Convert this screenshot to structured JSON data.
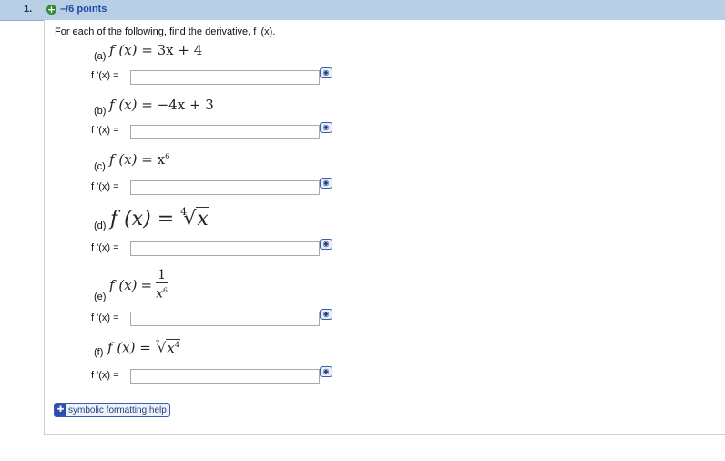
{
  "question": {
    "number": "1.",
    "points": "–/6 points",
    "prompt": "For each of the following, find the derivative, f '(x).",
    "answer_label": "f '(x) =",
    "parts": [
      {
        "label": "(a)",
        "answer": ""
      },
      {
        "label": "(b)",
        "answer": ""
      },
      {
        "label": "(c)",
        "answer": ""
      },
      {
        "label": "(d)",
        "answer": ""
      },
      {
        "label": "(e)",
        "answer": ""
      },
      {
        "label": "(f)",
        "answer": ""
      }
    ],
    "formulas": {
      "a": {
        "lhs": "f (x)",
        "rhs": "= 3x + 4"
      },
      "b": {
        "lhs": "f (x)",
        "rhs": "= −4x + 3"
      },
      "c": {
        "lhs": "f (x)",
        "base": "= x",
        "exp": "6"
      },
      "d": {
        "lhs": "f (x)",
        "eq": "=",
        "index": "4",
        "radicand": "x"
      },
      "e": {
        "lhs": "f (x)",
        "eq": "=",
        "num": "1",
        "den_base": "x",
        "den_exp": "6"
      },
      "f": {
        "lhs": "f (x)",
        "eq": "=",
        "index": "7",
        "radicand_base": "x",
        "radicand_exp": "4"
      }
    }
  },
  "help": {
    "label": "symbolic formatting help",
    "icon": "plus-icon"
  },
  "icons": {
    "preview": "eye-icon",
    "points": "plus-circle-icon"
  }
}
